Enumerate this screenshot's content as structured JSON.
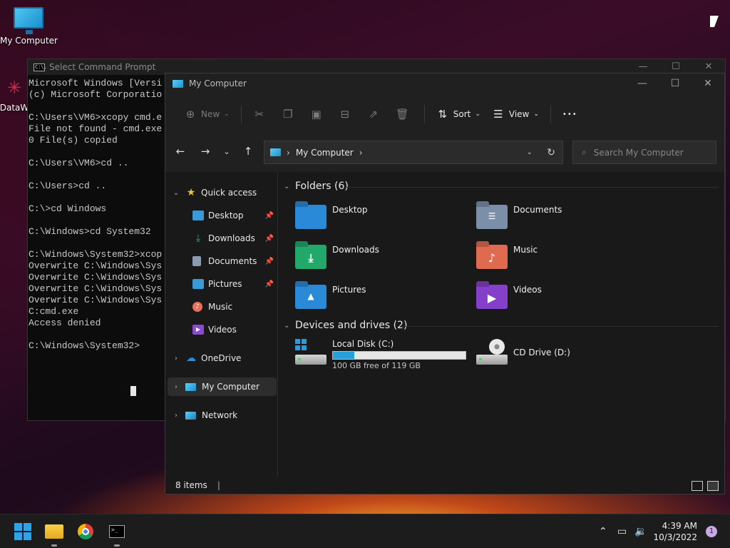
{
  "desktop": {
    "icons": [
      {
        "label": "My Computer"
      },
      {
        "label": "DataW"
      }
    ]
  },
  "cmd": {
    "title": "Select Command Prompt",
    "icon_text": "C:\\.",
    "lines": "Microsoft Windows [Versi\n(c) Microsoft Corporatio\n\nC:\\Users\\VM6>xcopy cmd.e\nFile not found - cmd.exe\n0 File(s) copied\n\nC:\\Users\\VM6>cd ..\n\nC:\\Users>cd ..\n\nC:\\>cd Windows\n\nC:\\Windows>cd System32\n\nC:\\Windows\\System32>xcop\nOverwrite C:\\Windows\\Sys\nOverwrite C:\\Windows\\Sys\nOverwrite C:\\Windows\\Sys\nOverwrite C:\\Windows\\Sys\nC:cmd.exe\nAccess denied\n\nC:\\Windows\\System32>"
  },
  "explorer": {
    "title": "My Computer",
    "toolbar": {
      "new_label": "New",
      "sort_label": "Sort",
      "view_label": "View",
      "more_label": "•••"
    },
    "address": {
      "path": "My Computer",
      "search_placeholder": "Search My Computer"
    },
    "nav": {
      "quick_access": "Quick access",
      "pinned": [
        {
          "label": "Desktop",
          "icon": "desktop-icon",
          "color": "#3a9ad9"
        },
        {
          "label": "Downloads",
          "icon": "download-icon",
          "color": "#2fb36f"
        },
        {
          "label": "Documents",
          "icon": "document-icon",
          "color": "#8a9bb0"
        },
        {
          "label": "Pictures",
          "icon": "picture-icon",
          "color": "#3a9ad9"
        },
        {
          "label": "Music",
          "icon": "music-icon",
          "color": "#e8705a"
        },
        {
          "label": "Videos",
          "icon": "video-icon",
          "color": "#8a4ad0"
        }
      ],
      "onedrive": "OneDrive",
      "my_computer": "My Computer",
      "network": "Network"
    },
    "folders_header": "Folders (6)",
    "folders": [
      {
        "label": "Desktop",
        "color": "#2a8ad8"
      },
      {
        "label": "Documents",
        "color": "#7c8fa8"
      },
      {
        "label": "Downloads",
        "color": "#22a86a"
      },
      {
        "label": "Music",
        "color": "#e06a50"
      },
      {
        "label": "Pictures",
        "color": "#2a8ad8"
      },
      {
        "label": "Videos",
        "color": "#8440c8"
      }
    ],
    "drives_header": "Devices and drives (2)",
    "drives": [
      {
        "label": "Local Disk (C:)",
        "free": "100 GB free of 119 GB",
        "used_fraction": 0.16
      },
      {
        "label": "CD Drive (D:)"
      }
    ],
    "status": "8 items"
  },
  "taskbar": {
    "time": "4:39 AM",
    "date": "10/3/2022",
    "notifications": "1"
  }
}
